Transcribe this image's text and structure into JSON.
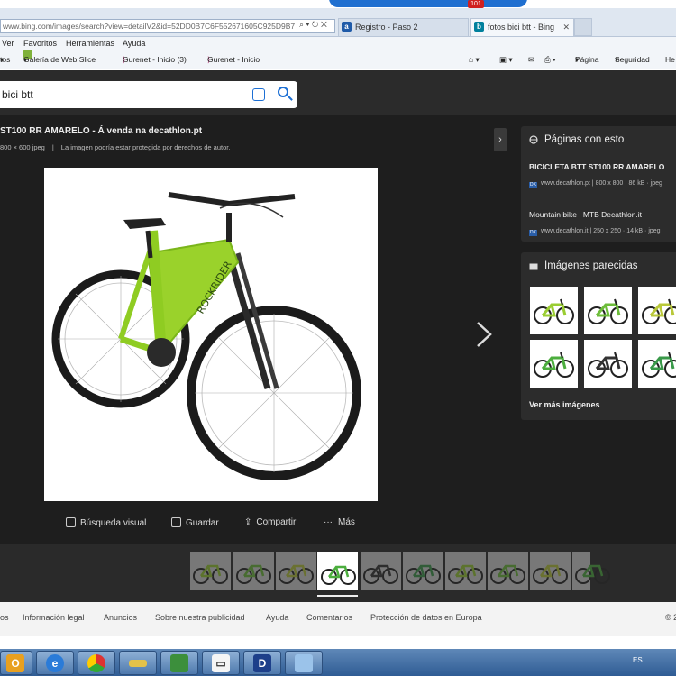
{
  "browser": {
    "address": "www.bing.com/images/search?view=detailV2&id=52DD0B7C6F552671605C925D9B7",
    "address_bold": "bing.com",
    "tabs": [
      {
        "label": "Registro - Paso 2",
        "icon": "a"
      },
      {
        "label": "fotos bici btt - Bing",
        "icon": "b"
      }
    ],
    "notification_count": "101",
    "menu": [
      "Ver",
      "Favoritos",
      "Herramientas",
      "Ayuda"
    ],
    "favorites": [
      "tos",
      "Galería de Web Slice",
      "Gurenet - Inicio (3)",
      "Gurenet - Inicio"
    ],
    "toolbar_right": [
      "Página",
      "Seguridad",
      "He"
    ]
  },
  "search": {
    "query": "bici btt"
  },
  "detail": {
    "title": "ST100 RR AMARELO - Á venda na decathlon.pt",
    "size": "800 × 600 jpeg",
    "rights": "La imagen podría estar protegida por derechos de autor.",
    "actions": [
      "Búsqueda visual",
      "Guardar",
      "Compartir",
      "Más"
    ]
  },
  "pages_with_this": {
    "heading": "Páginas con esto",
    "items": [
      {
        "title": "BICICLETA BTT ST100 RR AMARELO",
        "meta": "www.decathlon.pt | 800 x 800 · 86 kB · jpeg"
      },
      {
        "title": "Mountain bike | MTB Decathlon.it",
        "meta": "www.decathlon.it | 250 x 250 · 14 kB · jpeg"
      }
    ]
  },
  "similar": {
    "heading": "Imágenes parecidas",
    "see_more": "Ver más imágenes",
    "colors": [
      "#9acd32",
      "#6dbd3a",
      "#b9c83a",
      "#4cae3e",
      "#333333",
      "#3a9a4a"
    ]
  },
  "footer": {
    "links": [
      "os",
      "Información legal",
      "Anuncios",
      "Sobre nuestra publicidad",
      "Ayuda",
      "Comentarios",
      "Protección de datos en Europa"
    ],
    "copyright": "© 2"
  },
  "taskbar": {
    "lang": "ES"
  },
  "colors": {
    "accent": "#1c6fd4",
    "bike_green": "#8fd12a",
    "dark_bg": "#1e1e1e"
  }
}
